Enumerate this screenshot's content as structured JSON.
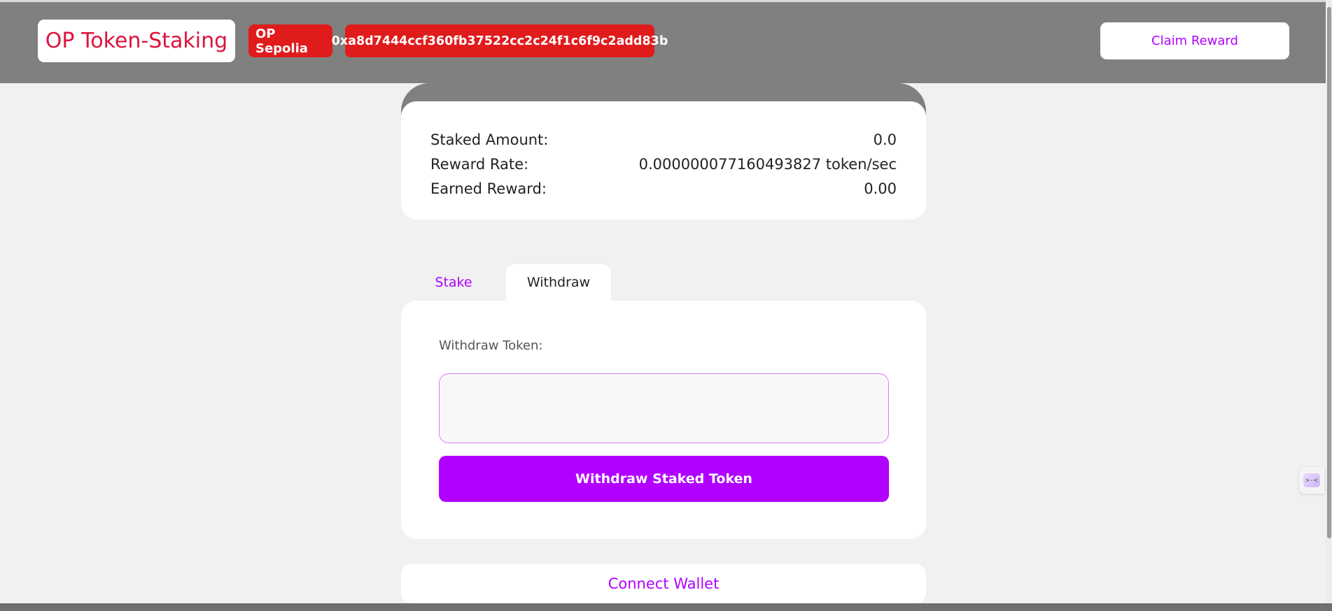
{
  "header": {
    "brand": "OP Token-Staking",
    "network": "OP Sepolia",
    "address": "0xa8d7444ccf360fb37522cc2c24f1c6f9c2add83b",
    "claim_label": "Claim Reward"
  },
  "stats": {
    "items": [
      {
        "label": "Staked Amount:",
        "value": "0.0"
      },
      {
        "label": "Reward Rate:",
        "value": "0.000000077160493827 token/sec"
      },
      {
        "label": "Earned Reward:",
        "value": "0.00"
      }
    ]
  },
  "tabs": [
    {
      "label": "Stake",
      "active": false
    },
    {
      "label": "Withdraw",
      "active": true
    }
  ],
  "withdraw": {
    "field_label": "Withdraw Token:",
    "input_value": "",
    "input_placeholder": "",
    "button_label": "Withdraw Staked Token"
  },
  "footer": {
    "connect_label": "Connect Wallet"
  },
  "widget": {
    "glyph": ">-<"
  },
  "colors": {
    "header_bg": "#808080",
    "brand_text": "#dc143c",
    "pill_bg": "#e01b1b",
    "accent": "#b100ff",
    "page_bg": "#f1f1f1"
  }
}
